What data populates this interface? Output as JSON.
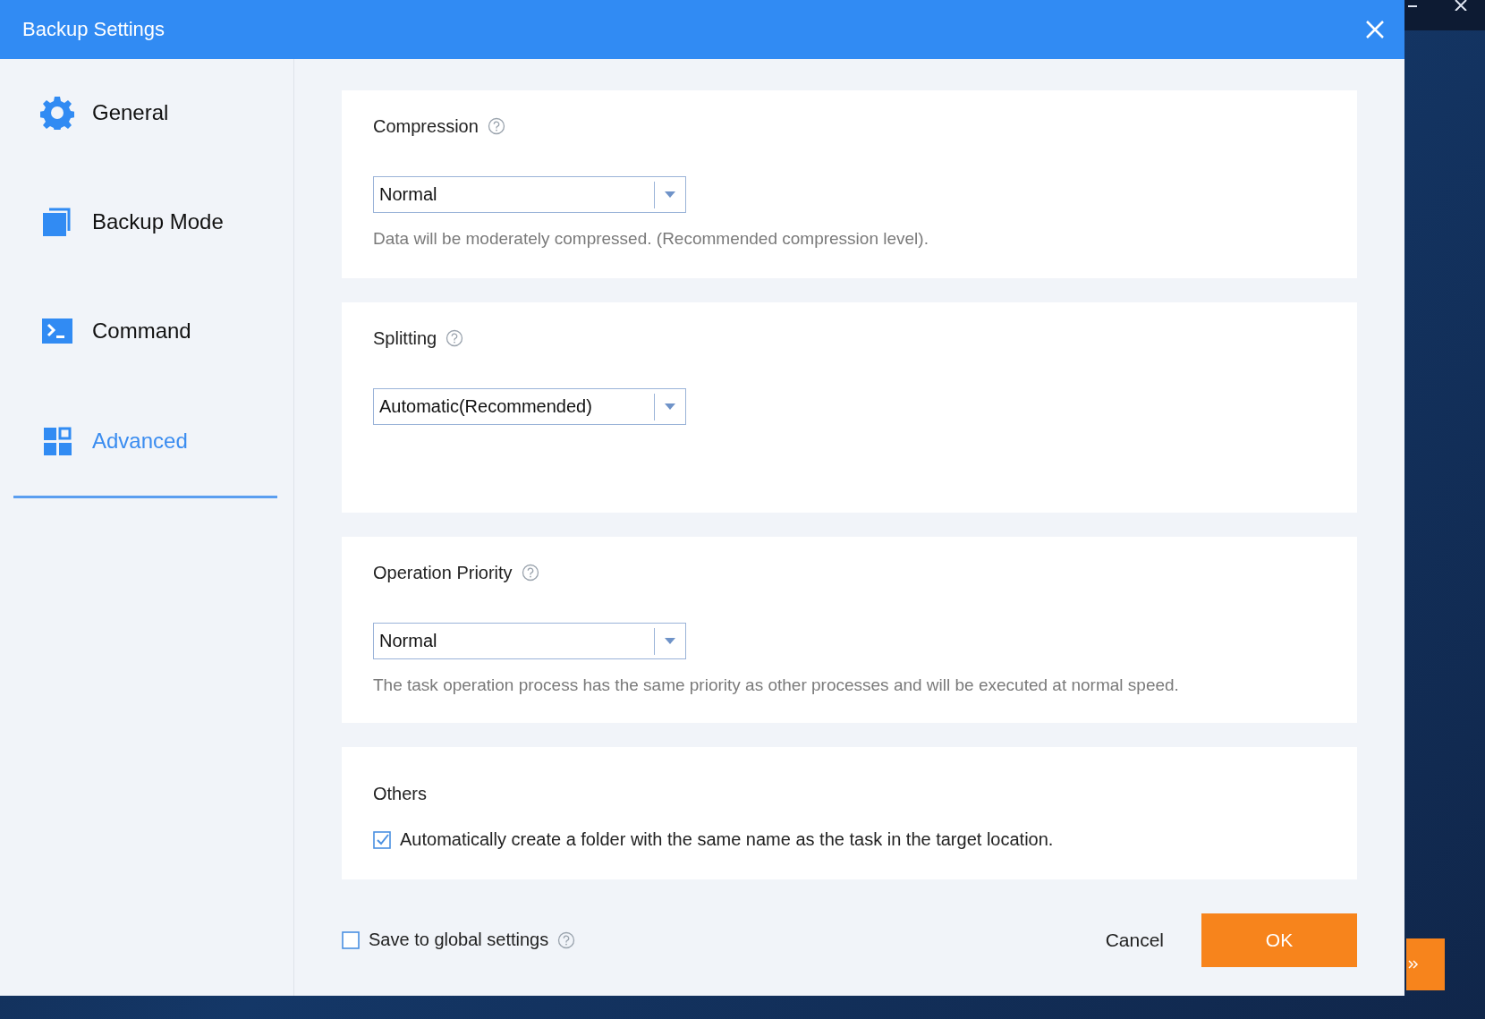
{
  "window": {
    "title": "Backup Settings"
  },
  "sidebar": {
    "items": [
      {
        "label": "General",
        "kind": "gear",
        "selected": false
      },
      {
        "label": "Backup Mode",
        "kind": "copy",
        "selected": false
      },
      {
        "label": "Command",
        "kind": "terminal",
        "selected": false
      },
      {
        "label": "Advanced",
        "kind": "grid",
        "selected": true
      }
    ]
  },
  "sections": [
    {
      "title": "Compression",
      "help": true,
      "kind": "dropdown",
      "value": "Normal",
      "description": "Data will be moderately compressed. (Recommended compression level)."
    },
    {
      "title": "Splitting",
      "help": true,
      "kind": "dropdown",
      "value": "Automatic(Recommended)"
    },
    {
      "title": "Operation Priority",
      "help": true,
      "kind": "dropdown",
      "value": "Normal",
      "description": "The task operation process has the same priority as other processes and will be executed at normal speed."
    },
    {
      "title": "Others",
      "kind": "checkbox",
      "label": "Automatically create a folder with the same name as the task in the target location.",
      "checked": true
    }
  ],
  "footer": {
    "save_global": {
      "label": "Save to global settings",
      "checked": false,
      "help": true
    },
    "buttons": [
      {
        "label": "Cancel",
        "kind": "text"
      },
      {
        "label": "OK",
        "kind": "primary"
      }
    ]
  }
}
